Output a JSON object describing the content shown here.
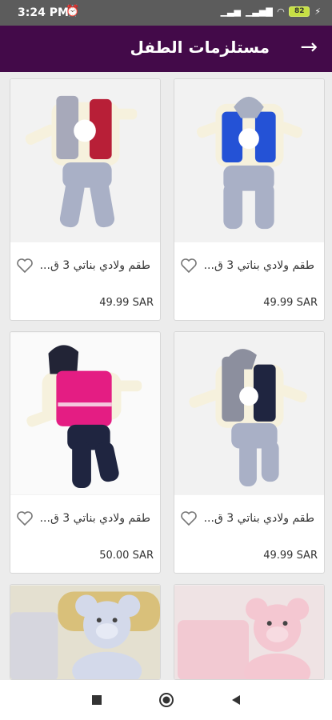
{
  "status": {
    "time": "3:24 PM",
    "battery": "82"
  },
  "app_bar": {
    "title": "مستلزمات الطفل"
  },
  "products": [
    {
      "name": "طقم ولادي بناتي 3 ق...",
      "price": "49.99 SAR"
    },
    {
      "name": "طقم ولادي بناتي 3 ق...",
      "price": "49.99 SAR"
    },
    {
      "name": "طقم ولادي بناتي 3 ق...",
      "price": "49.99 SAR"
    },
    {
      "name": "طقم ولادي بناتي 3 ق...",
      "price": "50.00 SAR"
    }
  ],
  "colors": {
    "app_bar": "#430a49",
    "status_bar": "#5c5c5c"
  },
  "icons": {
    "back": "arrow-right-icon",
    "favorite": "heart-outline-icon"
  }
}
